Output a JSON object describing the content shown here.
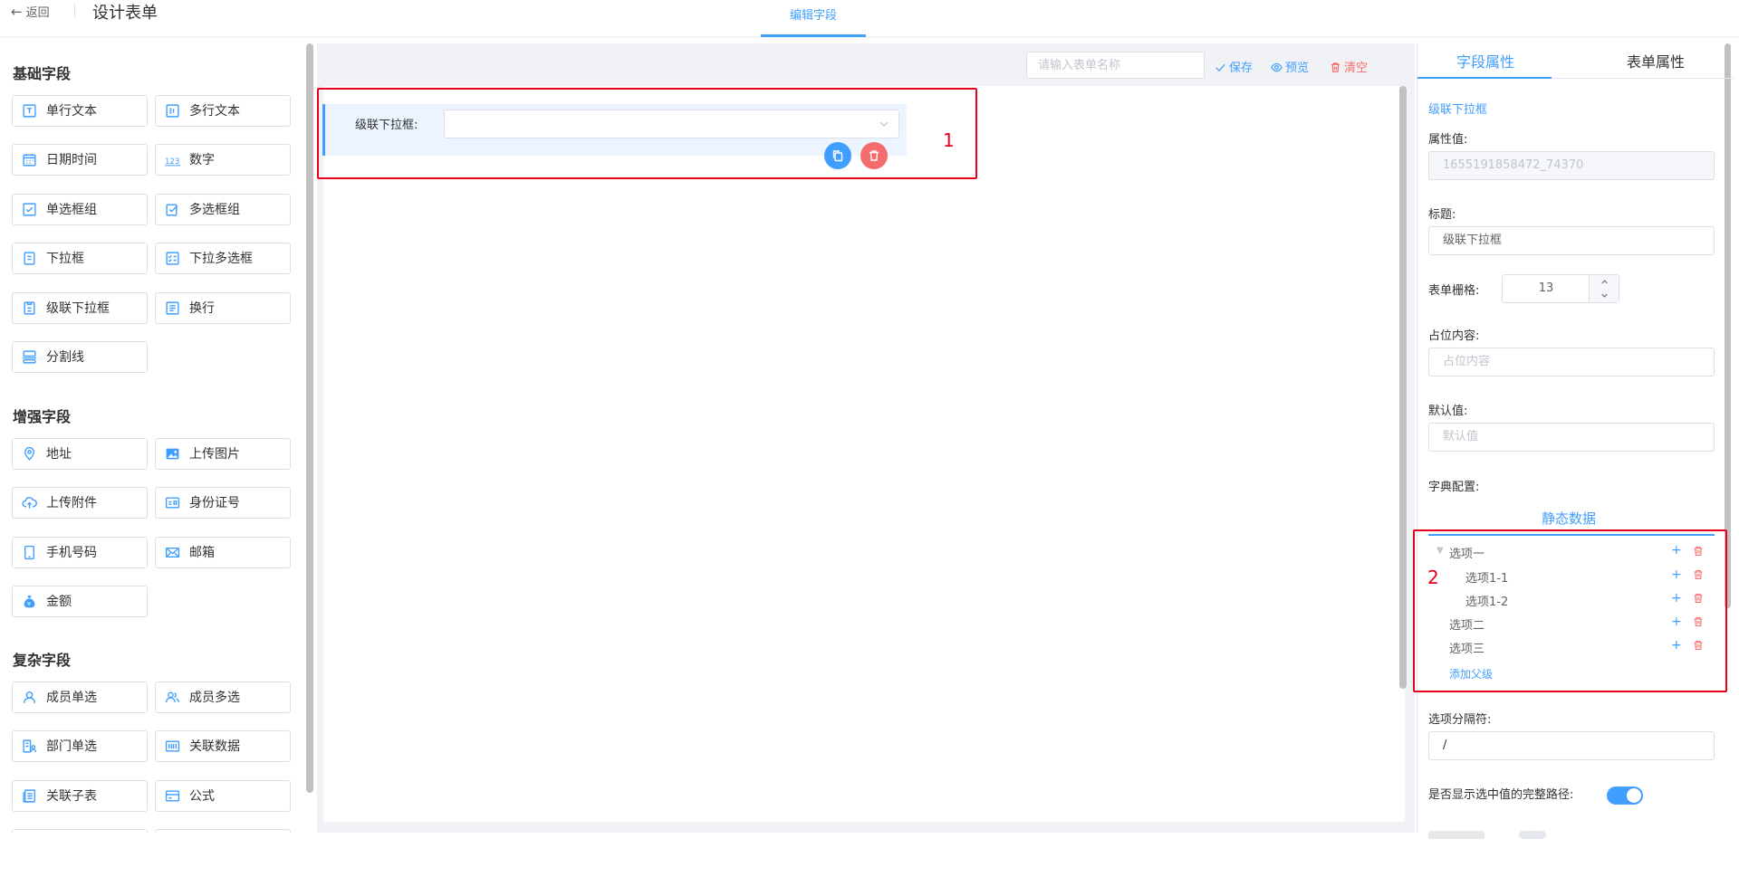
{
  "topbar": {
    "back_label": "返回",
    "page_title": "设计表单",
    "active_tab": "编辑字段"
  },
  "palette": {
    "groups": [
      {
        "title": "基础字段",
        "items": [
          {
            "label": "单行文本",
            "icon": "text-input-icon"
          },
          {
            "label": "多行文本",
            "icon": "textarea-icon"
          },
          {
            "label": "日期时间",
            "icon": "calendar-icon"
          },
          {
            "label": "数字",
            "icon": "number-icon"
          },
          {
            "label": "单选框组",
            "icon": "checkbox-icon"
          },
          {
            "label": "多选框组",
            "icon": "multi-checkbox-icon"
          },
          {
            "label": "下拉框",
            "icon": "document-icon"
          },
          {
            "label": "下拉多选框",
            "icon": "list-check-icon"
          },
          {
            "label": "级联下拉框",
            "icon": "cascade-icon"
          },
          {
            "label": "换行",
            "icon": "newline-icon"
          },
          {
            "label": "分割线",
            "icon": "divider-icon"
          }
        ]
      },
      {
        "title": "增强字段",
        "items": [
          {
            "label": "地址",
            "icon": "location-icon"
          },
          {
            "label": "上传图片",
            "icon": "image-icon"
          },
          {
            "label": "上传附件",
            "icon": "cloud-upload-icon"
          },
          {
            "label": "身份证号",
            "icon": "id-card-icon"
          },
          {
            "label": "手机号码",
            "icon": "phone-icon"
          },
          {
            "label": "邮箱",
            "icon": "mail-icon"
          },
          {
            "label": "金额",
            "icon": "money-bag-icon"
          }
        ]
      },
      {
        "title": "复杂字段",
        "items": [
          {
            "label": "成员单选",
            "icon": "user-icon"
          },
          {
            "label": "成员多选",
            "icon": "users-icon"
          },
          {
            "label": "部门单选",
            "icon": "department-icon"
          },
          {
            "label": "关联数据",
            "icon": "barcode-icon"
          },
          {
            "label": "关联子表",
            "icon": "subtable-icon"
          },
          {
            "label": "公式",
            "icon": "card-icon"
          }
        ]
      }
    ]
  },
  "toolbar": {
    "form_name_placeholder": "请输入表单名称",
    "save_label": "保存",
    "preview_label": "预览",
    "clear_label": "清空"
  },
  "canvas": {
    "field_label": "级联下拉框:",
    "annotation_1": "1",
    "annotation_2": "2"
  },
  "right_panel": {
    "tabs": [
      "字段属性",
      "表单属性"
    ],
    "component_name": "级联下拉框",
    "attr_value_label": "属性值:",
    "attr_value": "1655191858472_74370",
    "title_label": "标题:",
    "title_value": "级联下拉框",
    "grid_label": "表单栅格:",
    "grid_value": "13",
    "placeholder_label": "占位内容:",
    "placeholder_ph": "占位内容",
    "default_label": "默认值:",
    "default_ph": "默认值",
    "dict_label": "字典配置:",
    "dict_tab": "静态数据",
    "tree": [
      {
        "label": "选项一",
        "level": 0,
        "expanded": true
      },
      {
        "label": "选项1-1",
        "level": 1
      },
      {
        "label": "选项1-2",
        "level": 1
      },
      {
        "label": "选项二",
        "level": 0
      },
      {
        "label": "选项三",
        "level": 0
      }
    ],
    "add_parent_label": "添加父级",
    "separator_label": "选项分隔符:",
    "separator_value": "/",
    "full_path_label": "是否显示选中值的完整路径:",
    "full_path_enabled": true
  },
  "colors": {
    "accent": "#409eff",
    "danger": "#f56c6c",
    "annotation": "#e8001c"
  }
}
